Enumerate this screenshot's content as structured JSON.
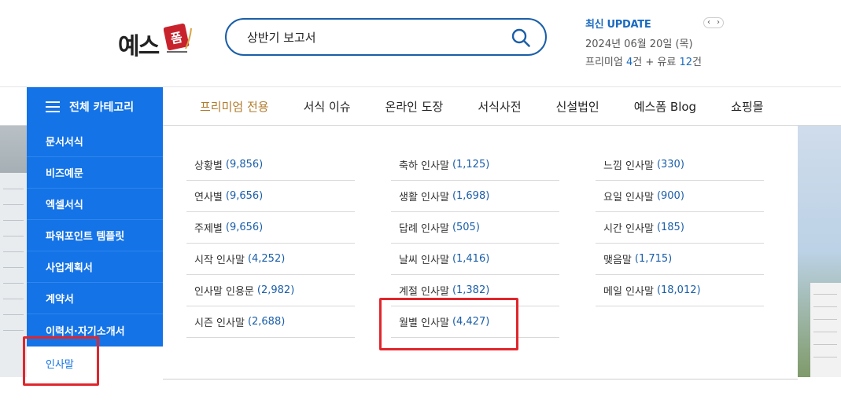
{
  "header": {
    "logo_text": "예스",
    "logo_stamp_text": "폼",
    "search": {
      "value": "상반기 보고서"
    },
    "update": {
      "title": "최신 UPDATE",
      "prev": "‹",
      "next": "›",
      "date": "2024년 06월 20일 (목)",
      "premium_label": "프리미엄",
      "premium_count": "4",
      "paid_label": "건 + 유료",
      "paid_count": "12",
      "unit": "건"
    }
  },
  "nav": {
    "all_categories": "전체 카테고리",
    "links": [
      "프리미엄 전용",
      "서식 이슈",
      "온라인 도장",
      "서식사전",
      "신설법인",
      "예스폼 Blog",
      "쇼핑몰"
    ]
  },
  "sidebar": {
    "items": [
      "문서서식",
      "비즈예문",
      "엑셀서식",
      "파워포인트 템플릿",
      "사업계획서",
      "계약서",
      "이력서·자기소개서"
    ],
    "active": "인사말"
  },
  "panel": {
    "col1": [
      {
        "name": "상황별",
        "count": "(9,856)"
      },
      {
        "name": "연사별",
        "count": "(9,656)"
      },
      {
        "name": "주제별",
        "count": "(9,656)"
      },
      {
        "name": "시작 인사말",
        "count": "(4,252)"
      },
      {
        "name": "인사말 인용문",
        "count": "(2,982)"
      },
      {
        "name": "시즌 인사말",
        "count": "(2,688)"
      }
    ],
    "col2": [
      {
        "name": "축하 인사말",
        "count": "(1,125)"
      },
      {
        "name": "생활 인사말",
        "count": "(1,698)"
      },
      {
        "name": "답례 인사말",
        "count": "(505)"
      },
      {
        "name": "날씨 인사말",
        "count": "(1,416)"
      },
      {
        "name": "계절 인사말",
        "count": "(1,382)"
      },
      {
        "name": "월별 인사말",
        "count": "(4,427)"
      }
    ],
    "col3": [
      {
        "name": "느낌 인사말",
        "count": "(330)"
      },
      {
        "name": "요일 인사말",
        "count": "(900)"
      },
      {
        "name": "시간 인사말",
        "count": "(185)"
      },
      {
        "name": "맺음말",
        "count": "(1,715)"
      },
      {
        "name": "메일 인사말",
        "count": "(18,012)"
      }
    ]
  },
  "colors": {
    "brand_blue": "#1473e6",
    "search_border": "#1a5ea8",
    "premium_gold": "#b07a2a",
    "highlight_red": "#e0262c",
    "logo_red": "#c8232c"
  }
}
